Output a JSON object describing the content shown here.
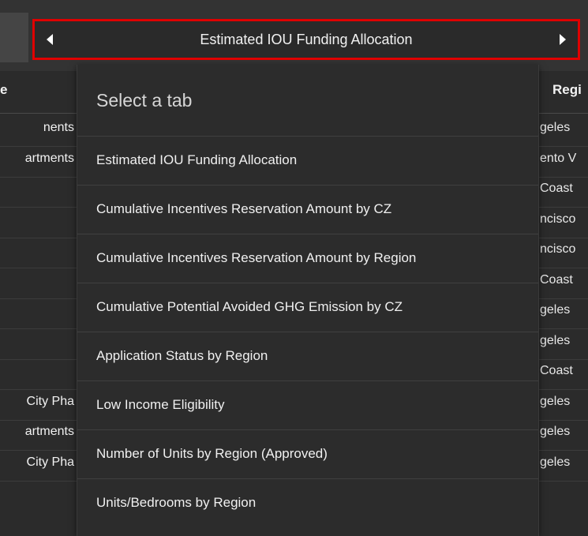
{
  "header": {
    "title": "Estimated IOU Funding Allocation"
  },
  "table": {
    "columns": [
      "e",
      "Regi"
    ],
    "rows": [
      {
        "left": "nents",
        "right": "geles"
      },
      {
        "left": "artments",
        "right": "ento V"
      },
      {
        "left": "",
        "right": "Coast"
      },
      {
        "left": "",
        "right": "ncisco"
      },
      {
        "left": "",
        "right": "ncisco"
      },
      {
        "left": "",
        "right": "Coast"
      },
      {
        "left": "",
        "right": "geles"
      },
      {
        "left": "",
        "right": "geles"
      },
      {
        "left": "",
        "right": "Coast"
      },
      {
        "left": "City Pha",
        "right": "geles"
      },
      {
        "left": "artments",
        "right": "geles"
      },
      {
        "left": "City Pha",
        "right": "geles"
      }
    ]
  },
  "dropdown": {
    "header": "Select a tab",
    "items": [
      "Estimated IOU Funding Allocation",
      "Cumulative Incentives Reservation Amount by CZ",
      "Cumulative Incentives Reservation Amount by Region",
      "Cumulative Potential Avoided GHG Emission by CZ",
      "Application Status by Region",
      "Low Income Eligibility",
      "Number of Units by Region (Approved)",
      "Units/Bedrooms by Region"
    ]
  },
  "colors": {
    "highlight_border": "#e00000",
    "background": "#2f2f2f"
  }
}
